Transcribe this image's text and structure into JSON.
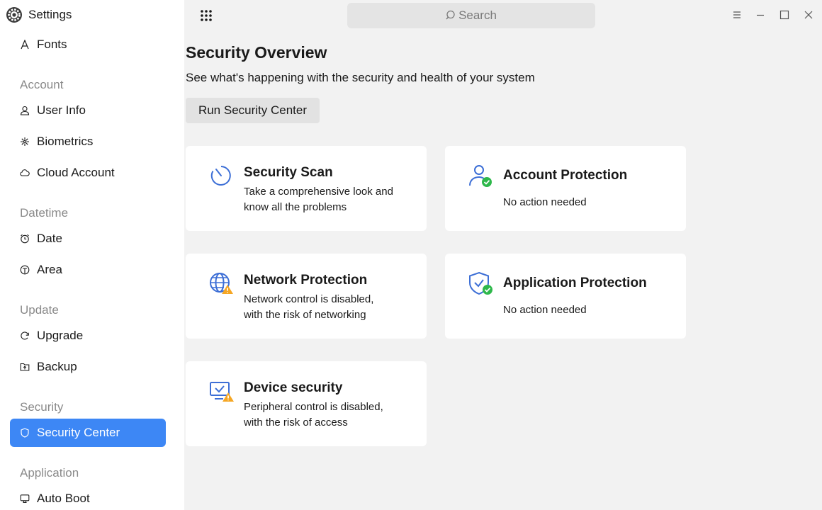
{
  "app": {
    "title": "Settings"
  },
  "search": {
    "placeholder": "Search"
  },
  "sidebar": {
    "partial_item": "Fonts",
    "groups": [
      {
        "label": "Account",
        "items": [
          {
            "label": "User Info",
            "icon": "user-icon"
          },
          {
            "label": "Biometrics",
            "icon": "biometrics-icon"
          },
          {
            "label": "Cloud Account",
            "icon": "cloud-icon"
          }
        ]
      },
      {
        "label": "Datetime",
        "items": [
          {
            "label": "Date",
            "icon": "clock-icon"
          },
          {
            "label": "Area",
            "icon": "area-icon"
          }
        ]
      },
      {
        "label": "Update",
        "items": [
          {
            "label": "Upgrade",
            "icon": "upgrade-icon"
          },
          {
            "label": "Backup",
            "icon": "backup-icon"
          }
        ]
      },
      {
        "label": "Security",
        "items": [
          {
            "label": "Security Center",
            "icon": "shield-icon",
            "active": true
          }
        ]
      },
      {
        "label": "Application",
        "items": [
          {
            "label": "Auto Boot",
            "icon": "autoboot-icon"
          }
        ]
      }
    ]
  },
  "main": {
    "title": "Security Overview",
    "subtitle": "See what's happening with the security and health of your system",
    "run_button": "Run Security Center",
    "cards": [
      {
        "title": "Security Scan",
        "desc1": "Take a comprehensive look and",
        "desc2": "know all the problems",
        "icon": "scan-icon"
      },
      {
        "title": "Account Protection",
        "desc1": "No action needed",
        "desc2": "",
        "icon": "account-ok-icon"
      },
      {
        "title": "Network Protection",
        "desc1": "Network control is disabled,",
        "desc2": "with the risk of networking",
        "icon": "network-warning-icon"
      },
      {
        "title": "Application Protection",
        "desc1": "No action needed",
        "desc2": "",
        "icon": "app-shield-ok-icon"
      },
      {
        "title": "Device security",
        "desc1": "Peripheral control is disabled,",
        "desc2": "with the risk of access",
        "icon": "device-warning-icon"
      }
    ]
  },
  "colors": {
    "accent": "#3d87f5",
    "ok": "#2eb84b",
    "warning": "#f5a623",
    "icon_blue": "#3d6fd6"
  }
}
